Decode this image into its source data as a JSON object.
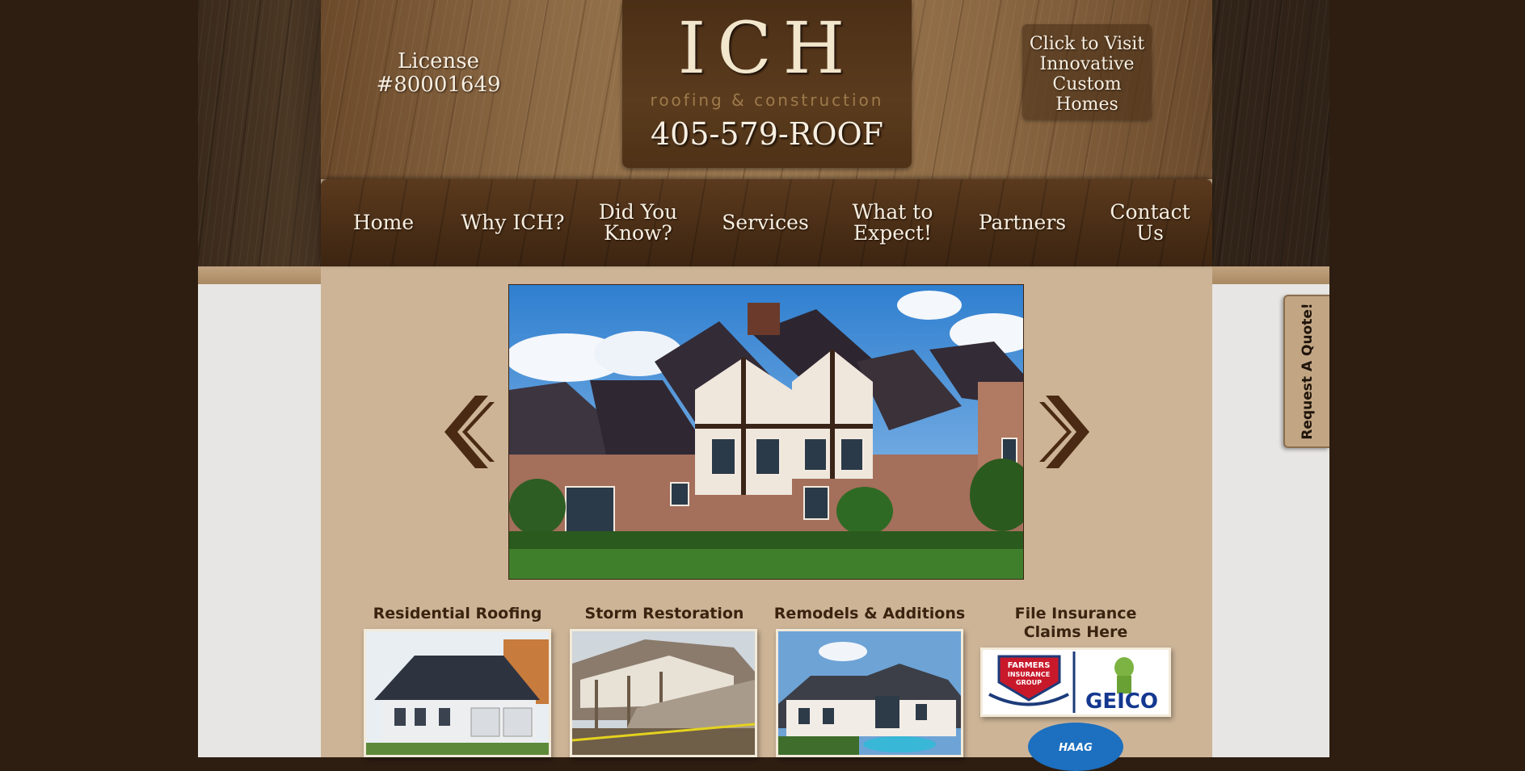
{
  "header": {
    "license_line1": "License",
    "license_line2": "#80001649",
    "logo": "ICH",
    "logo_sub": "roofing & construction",
    "phone": "405-579-ROOF",
    "visit_line1": "Click to Visit",
    "visit_line2": "Innovative",
    "visit_line3": "Custom",
    "visit_line4": "Homes"
  },
  "nav": {
    "items": [
      {
        "line1": "Home",
        "line2": ""
      },
      {
        "line1": "Why ICH?",
        "line2": ""
      },
      {
        "line1": "Did You",
        "line2": "Know?"
      },
      {
        "line1": "Services",
        "line2": ""
      },
      {
        "line1": "What to",
        "line2": "Expect!"
      },
      {
        "line1": "Partners",
        "line2": ""
      },
      {
        "line1": "Contact",
        "line2": "Us"
      }
    ]
  },
  "slider": {
    "prev_icon": "chevron-left-icon",
    "next_icon": "chevron-right-icon"
  },
  "services": [
    {
      "title": "Residential Roofing"
    },
    {
      "title": "Storm Restoration"
    },
    {
      "title": "Remodels & Additions"
    }
  ],
  "insurance": {
    "title_line1": "File Insurance",
    "title_line2": "Claims Here",
    "farmers_line1": "FARMERS",
    "farmers_line2": "INSURANCE",
    "farmers_line3": "GROUP",
    "geico": "GEICO",
    "haag": "HAAG"
  },
  "quote_tab": "Request A Quote!",
  "colors": {
    "background": "#2e1e12",
    "column": "#cdb497",
    "nav": "#4a2e16",
    "text_light": "#f7efe2",
    "title_dark": "#3a230f"
  }
}
